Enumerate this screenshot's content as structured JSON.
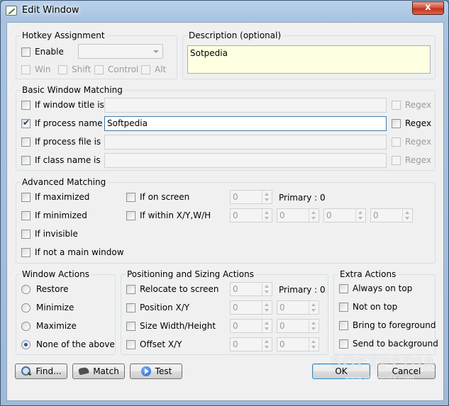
{
  "window": {
    "title": "Edit Window",
    "close_label": "x"
  },
  "hotkey": {
    "group_title": "Hotkey Assignment",
    "enable_label": "Enable",
    "modifiers": [
      "Win",
      "Shift",
      "Control",
      "Alt"
    ]
  },
  "description": {
    "group_title": "Description (optional)",
    "value": "Sotpedia"
  },
  "basic": {
    "group_title": "Basic Window Matching",
    "rows": [
      {
        "label": "If window title is",
        "checked": false,
        "value": "",
        "regex_label": "Regex"
      },
      {
        "label": "If process name is",
        "checked": true,
        "value": "Softpedia",
        "regex_label": "Regex"
      },
      {
        "label": "If process file is",
        "checked": false,
        "value": "",
        "regex_label": "Regex"
      },
      {
        "label": "If class name is",
        "checked": false,
        "value": "",
        "regex_label": "Regex"
      }
    ]
  },
  "advanced": {
    "group_title": "Advanced Matching",
    "maximized": "If maximized",
    "minimized": "If minimized",
    "invisible": "If invisible",
    "not_main": "If not a main window",
    "on_screen": "If on screen",
    "within": "If within X/Y,W/H",
    "spin_value": "0",
    "primary": "Primary : 0"
  },
  "window_actions": {
    "group_title": "Window Actions",
    "options": [
      "Restore",
      "Minimize",
      "Maximize",
      "None of the above"
    ],
    "selected": "None of the above"
  },
  "positioning": {
    "group_title": "Positioning and Sizing Actions",
    "relocate": "Relocate to screen",
    "position": "Position X/Y",
    "size": "Size Width/Height",
    "offset": "Offset X/Y",
    "spin_value": "0",
    "primary": "Primary : 0"
  },
  "extra": {
    "group_title": "Extra Actions",
    "options": [
      "Always on top",
      "Not on top",
      "Bring to foreground",
      "Send to background"
    ]
  },
  "buttons": {
    "find": "Find...",
    "match": "Match",
    "test": "Test",
    "ok": "OK",
    "cancel": "Cancel"
  },
  "watermark": {
    "text": "SOFTPEDIA",
    "url": "www.softpedia.com"
  }
}
